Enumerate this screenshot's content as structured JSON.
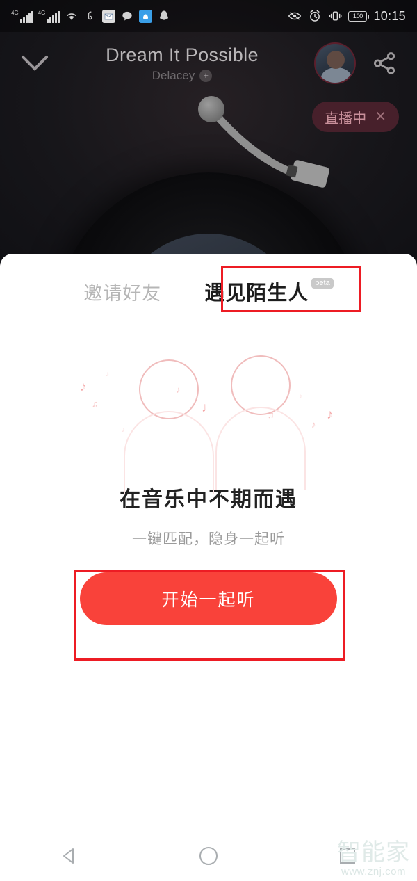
{
  "status_bar": {
    "network_label": "4G",
    "icons": [
      "signal-4g-icon",
      "signal-4g-icon",
      "wifi-icon",
      "netease-music-icon",
      "mail-icon",
      "message-icon",
      "qq-mobile-icon",
      "qq-penguin-icon"
    ],
    "right_icons": [
      "eye-comfort-icon",
      "alarm-icon",
      "vibrate-icon"
    ],
    "battery_level": "100",
    "clock": "10:15"
  },
  "player": {
    "collapse_icon": "chevron-down-icon",
    "song_title": "Dream It Possible",
    "artist": "Delacey",
    "artist_add_label": "+",
    "avatar_name": "user-avatar",
    "share_icon": "share-icon",
    "live_badge": {
      "label": "直播中",
      "close_label": "✕",
      "bg": "#47202b",
      "text_color": "#c9909b"
    },
    "turntable": {
      "disc_name": "vinyl-record",
      "tonearm_name": "tonearm"
    }
  },
  "sheet": {
    "tabs": [
      {
        "label": "邀请好友",
        "active": false
      },
      {
        "label": "遇见陌生人",
        "active": true,
        "badge": "beta"
      }
    ],
    "illustration_name": "two-people-listening-illustration",
    "headline": "在音乐中不期而遇",
    "subtitle": "一键匹配，隐身一起听",
    "cta_label": "开始一起听",
    "cta_color": "#f9423a"
  },
  "annotations": {
    "highlight_color": "#ed1c24",
    "boxes": [
      "遇见陌生人",
      "开始一起听"
    ]
  },
  "nav_bar": {
    "back_icon": "back-triangle-icon",
    "home_icon": "home-circle-icon",
    "recents_icon": "recents-square-icon"
  },
  "watermark": {
    "logo": "智能家",
    "url": "www.znj.com"
  }
}
